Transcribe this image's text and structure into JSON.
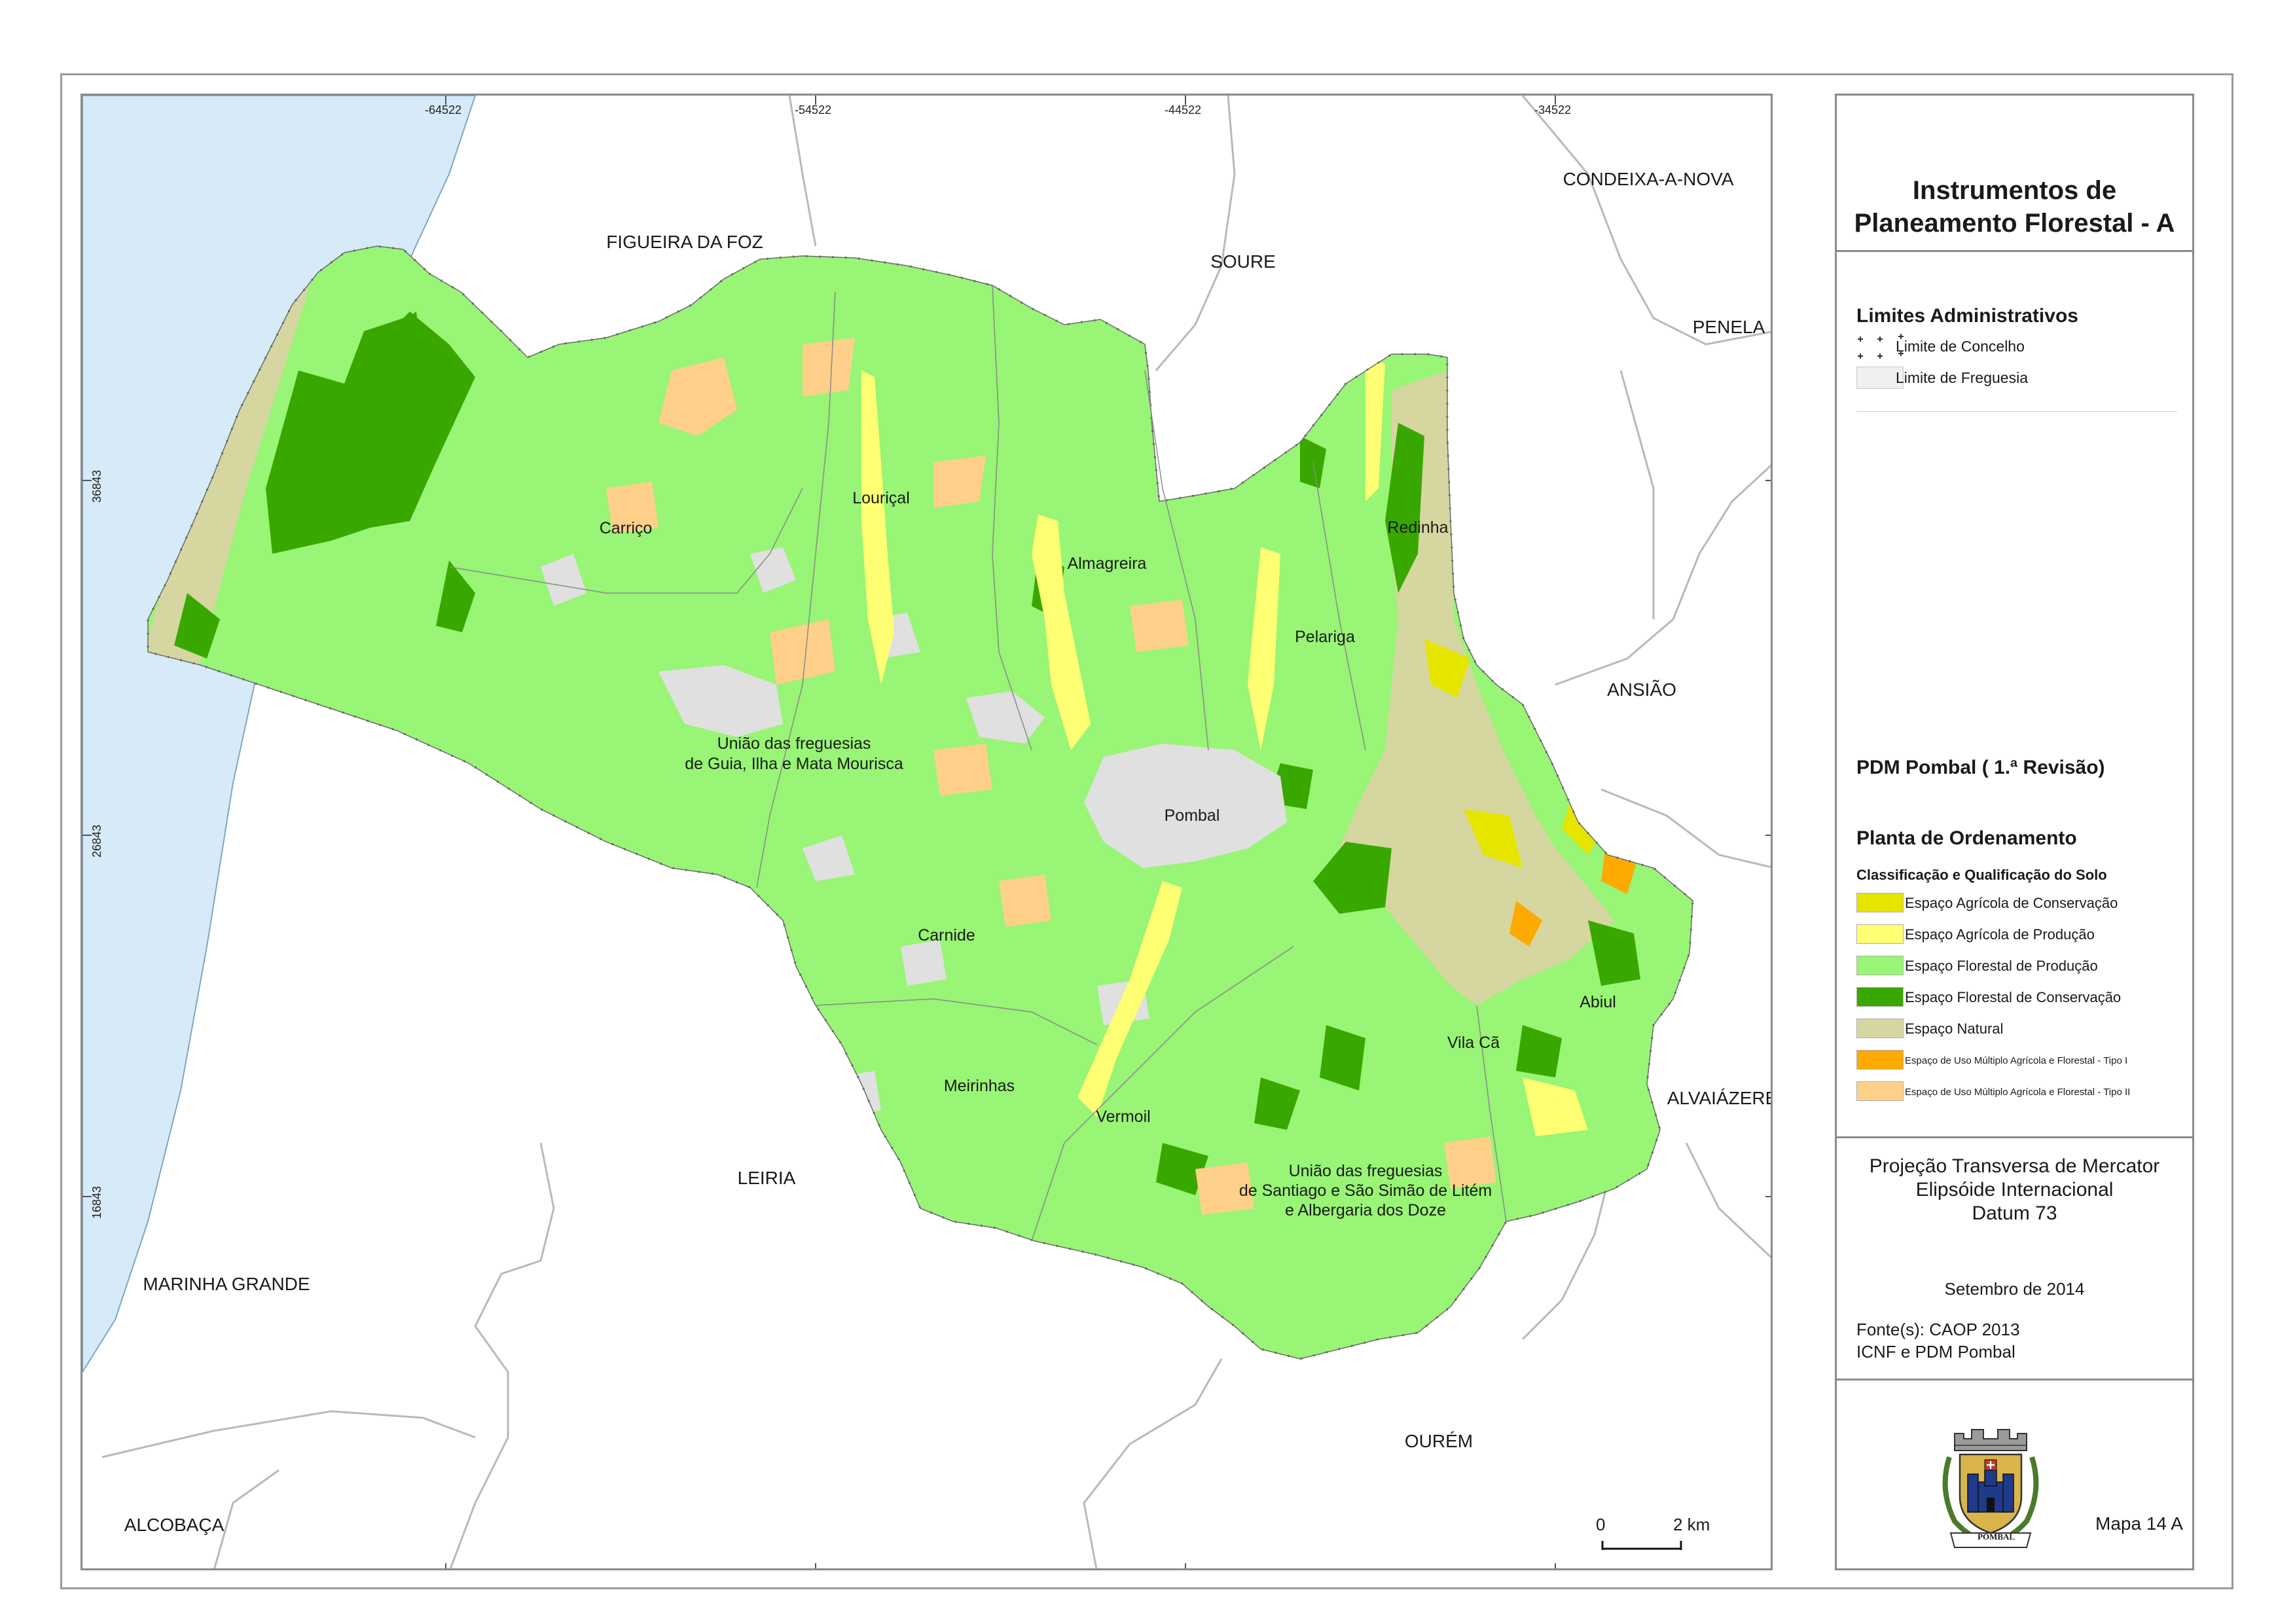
{
  "title_line1": "Instrumentos de",
  "title_line2": "Planeamento Florestal - A",
  "admin": {
    "title": "Limites Administrativos",
    "concelho": "Limite de Concelho",
    "freguesia": "Limite de Freguesia"
  },
  "pdm": {
    "title": "PDM Pombal ( 1.ª Revisão)",
    "plan": "Planta de Ordenamento",
    "classification": "Classificação e Qualificação do Solo",
    "classes": [
      {
        "label": "Espaço Agrícola de Conservação",
        "color": "#e5e500"
      },
      {
        "label": "Espaço Agrícola de Produção",
        "color": "#ffff73"
      },
      {
        "label": "Espaço Florestal de Produção",
        "color": "#98f575"
      },
      {
        "label": "Espaço Florestal de Conservação",
        "color": "#38a800"
      },
      {
        "label": "Espaço Natural",
        "color": "#d6d6a0"
      },
      {
        "label": "Espaço de Uso Múltiplo Agrícola e Florestal - Tipo I",
        "color": "#ffaa00"
      },
      {
        "label": "Espaço de Uso Múltiplo Agrícola e Florestal - Tipo II",
        "color": "#ffd08a"
      }
    ]
  },
  "projection": {
    "line1": "Projeção Transversa de Mercator",
    "line2": "Elipsóide Internacional",
    "line3": "Datum 73"
  },
  "date": "Setembro de 2014",
  "sources": {
    "line1": "Fonte(s): CAOP 2013",
    "line2": "ICNF e PDM Pombal"
  },
  "map_number": "Mapa 14 A",
  "crest_text": "POMBAL",
  "scale": {
    "zero": "0",
    "label": "2 km"
  },
  "ticks": {
    "x": [
      "-64522",
      "-54522",
      "-44522",
      "-34522"
    ],
    "y": [
      "36843",
      "26843",
      "16843"
    ]
  },
  "neighbors": {
    "figueira": "FIGUEIRA DA FOZ",
    "soure": "SOURE",
    "condeixa": "CONDEIXA-A-NOVA",
    "penela": "PENELA",
    "ansiao": "ANSIÃO",
    "alvaiazere": "ALVAIÁZERE",
    "leiria": "LEIRIA",
    "marinha": "MARINHA GRANDE",
    "alcobaca": "ALCOBAÇA",
    "ourem": "OURÉM"
  },
  "parishes": {
    "lourical": "Louriçal",
    "carrico": "Carriço",
    "almagreira": "Almagreira",
    "redinha": "Redinha",
    "pelariga": "Pelariga",
    "guia_l1": "União das freguesias",
    "guia_l2": "de Guia, Ilha e Mata Mourisca",
    "pombal": "Pombal",
    "carnide": "Carnide",
    "abiul": "Abiul",
    "vilaca": "Vila Cã",
    "meirinhas": "Meirinhas",
    "vermoil": "Vermoil",
    "santiago_l1": "União das freguesias",
    "santiago_l2": "de Santiago e São Simão de Litém",
    "santiago_l3": "e Albergaria dos Doze"
  }
}
